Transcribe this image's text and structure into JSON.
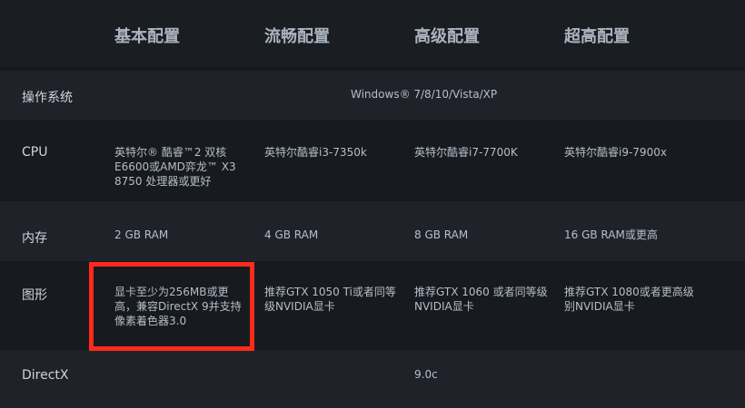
{
  "header": {
    "columns": [
      "基本配置",
      "流畅配置",
      "高级配置",
      "超高配置"
    ]
  },
  "rows": {
    "os": {
      "label": "操作系统",
      "value": "Windows® 7/8/10/Vista/XP"
    },
    "cpu": {
      "label": "CPU",
      "values": [
        "英特尔® 酷睿™2 双核 E6600或AMD弈龙™ X3 8750 处理器或更好",
        "英特尔酷睿i3-7350k",
        "英特尔酷睿i7-7700K",
        "英特尔酷睿i9-7900x"
      ]
    },
    "memory": {
      "label": "内存",
      "values": [
        "2 GB RAM",
        "4 GB RAM",
        "8 GB RAM",
        "16 GB RAM或更高"
      ]
    },
    "graphics": {
      "label": "图形",
      "values": [
        "显卡至少为256MB或更高，兼容DirectX 9并支持像素着色器3.0",
        "推荐GTX 1050 Ti或者同等级NVIDIA显卡",
        "推荐GTX 1060 或者同等级NVIDIA显卡",
        "推荐GTX 1080或者更高级别NVIDIA显卡"
      ]
    },
    "directx": {
      "label": "DirectX",
      "value": "9.0c"
    }
  },
  "colors": {
    "highlight": "#ff2a1a",
    "background": "#16191e"
  }
}
